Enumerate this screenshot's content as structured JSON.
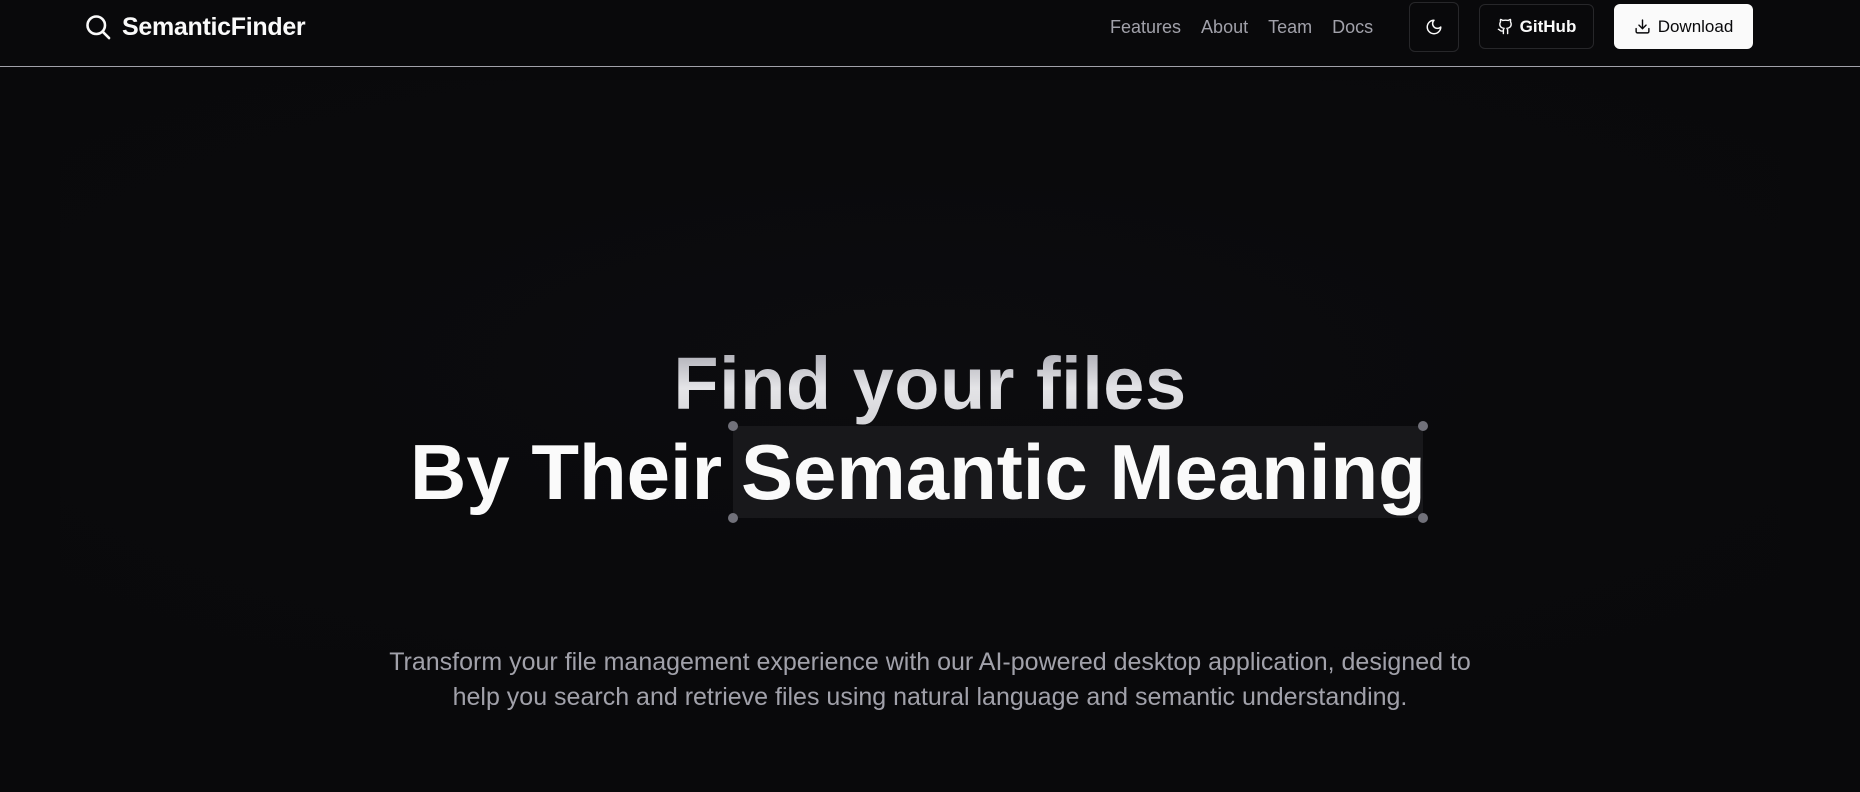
{
  "header": {
    "brand": {
      "name": "SemanticFinder",
      "icon": "search-icon"
    },
    "nav": [
      {
        "label": "Features"
      },
      {
        "label": "About"
      },
      {
        "label": "Team"
      },
      {
        "label": "Docs"
      }
    ],
    "theme_toggle": {
      "icon": "moon-icon"
    },
    "github": {
      "label": "GitHub",
      "icon": "github-icon"
    },
    "download": {
      "label": "Download",
      "icon": "download-icon"
    }
  },
  "hero": {
    "line1": "Find your files",
    "line2_prefix": "By Their",
    "line2_highlight": "Semantic Meaning",
    "description": "Transform your file management experience with our AI-powered desktop application, designed to help you search and retrieve files using natural language and semantic understanding."
  },
  "colors": {
    "background": "#09090b",
    "foreground": "#fafafa",
    "muted": "#a1a1aa",
    "border": "#27272a",
    "highlight": "#18181b"
  }
}
